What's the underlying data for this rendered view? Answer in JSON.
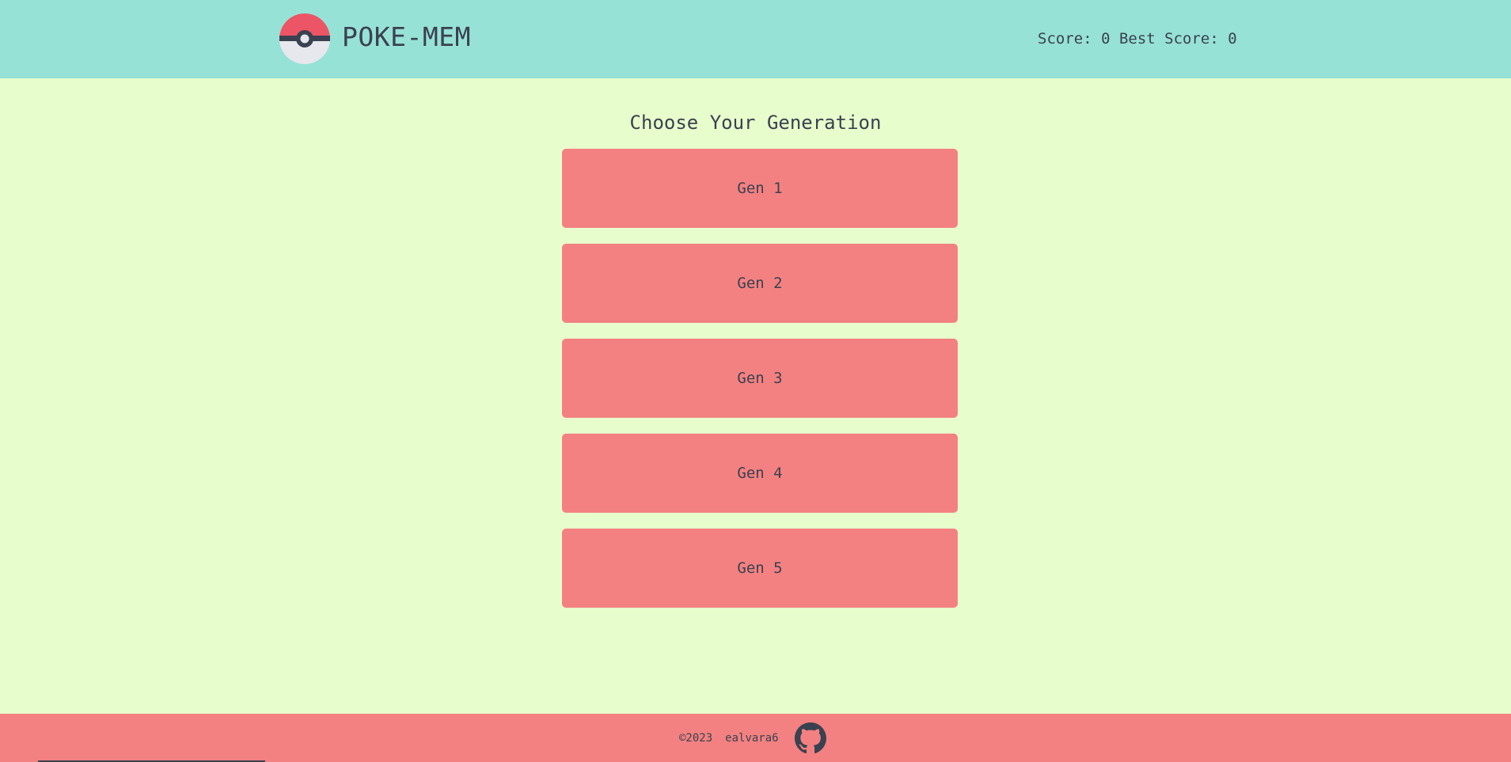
{
  "header": {
    "title": "POKE-MEM",
    "logo_icon": "pokeball-icon",
    "score_text": "Score: 0 Best Score: 0"
  },
  "main": {
    "heading": "Choose Your Generation",
    "generations": [
      {
        "label": "Gen 1"
      },
      {
        "label": "Gen 2"
      },
      {
        "label": "Gen 3"
      },
      {
        "label": "Gen 4"
      },
      {
        "label": "Gen 5"
      }
    ]
  },
  "footer": {
    "copyright": "©2023",
    "author": "ealvara6",
    "link_icon": "github-icon"
  },
  "colors": {
    "header_bg": "#97e2d6",
    "page_bg": "#e8fdcc",
    "accent": "#f38181",
    "text": "#3a4150"
  }
}
